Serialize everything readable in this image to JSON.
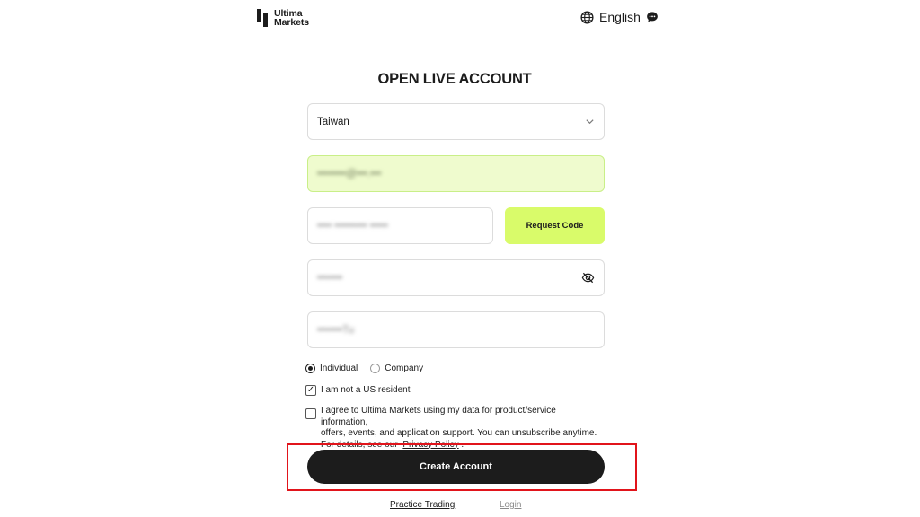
{
  "brand": {
    "line1": "Ultima",
    "line2": "Markets"
  },
  "header": {
    "language_label": "English",
    "globe_icon": "globe-icon",
    "chat_icon": "chat-icon"
  },
  "form": {
    "title": "OPEN LIVE ACCOUNT",
    "country_value": "Taiwan",
    "email_value": "••••••••@•••.•••",
    "code_value": "•••• ••••••••• •••••",
    "request_code_label": "Request Code",
    "password_value": "•••••••",
    "referral_value": "•••••••Tu",
    "account_types": [
      {
        "label": "Individual",
        "selected": true
      },
      {
        "label": "Company",
        "selected": false
      }
    ],
    "us_resident_label": "I am not a US resident",
    "us_resident_checked": true,
    "agree_text_line1": "I agree to Ultima Markets using my data for product/service information,",
    "agree_text_line2": "offers, events, and application support. You can unsubscribe anytime.",
    "agree_text_line3": "For details, see our",
    "privacy_link": "Privacy Policy",
    "agree_text_end": ".",
    "agree_checked": false,
    "create_account_label": "Create Account",
    "check_mark": "✓"
  },
  "footer": {
    "practice_label": "Practice Trading",
    "login_label": "Login"
  },
  "colors": {
    "accent_lime": "#d9fb6a",
    "email_bg": "#effbce",
    "button_dark": "#1c1c1c",
    "highlight_red": "#e1141b"
  }
}
